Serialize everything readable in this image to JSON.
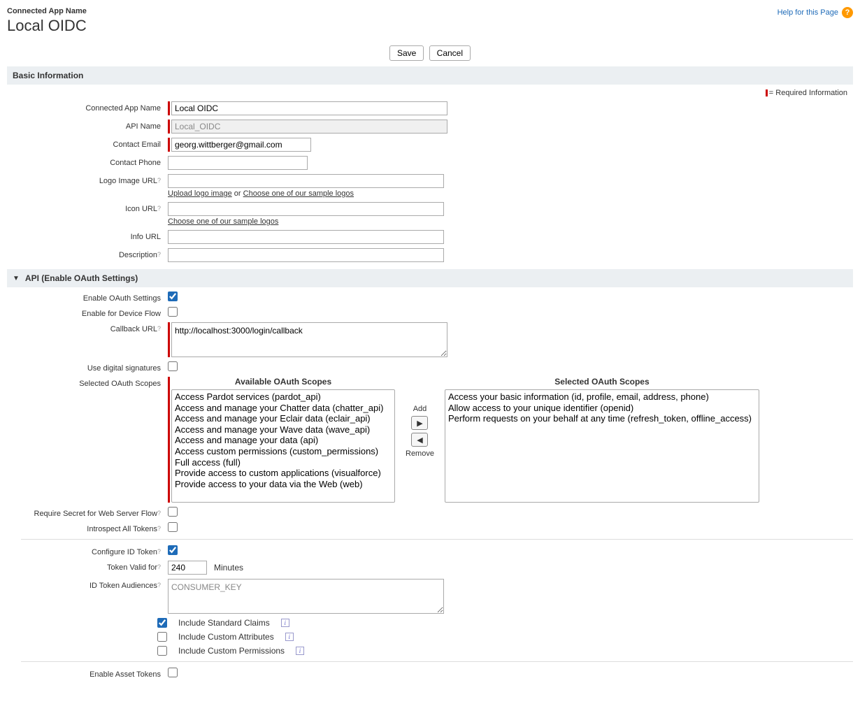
{
  "header": {
    "superlabel": "Connected App Name",
    "title": "Local OIDC",
    "help_link": "Help for this Page"
  },
  "buttons": {
    "save": "Save",
    "cancel": "Cancel"
  },
  "sections": {
    "basic_info": "Basic Information",
    "api": "API (Enable OAuth Settings)"
  },
  "required_info": "= Required Information",
  "labels": {
    "connected_app_name": "Connected App Name",
    "api_name": "API Name",
    "contact_email": "Contact Email",
    "contact_phone": "Contact Phone",
    "logo_url": "Logo Image URL",
    "icon_url": "Icon URL",
    "info_url": "Info URL",
    "description": "Description",
    "enable_oauth": "Enable OAuth Settings",
    "enable_device": "Enable for Device Flow",
    "callback_url": "Callback URL",
    "digital_sig": "Use digital signatures",
    "selected_scopes": "Selected OAuth Scopes",
    "available_scopes_title": "Available OAuth Scopes",
    "selected_scopes_title": "Selected OAuth Scopes",
    "require_secret": "Require Secret for Web Server Flow",
    "introspect": "Introspect All Tokens",
    "configure_id_token": "Configure ID Token",
    "token_valid": "Token Valid for",
    "minutes": "Minutes",
    "id_audiences": "ID Token Audiences",
    "std_claims": "Include Standard Claims",
    "custom_attrs": "Include Custom Attributes",
    "custom_perms": "Include Custom Permissions",
    "enable_asset": "Enable Asset Tokens",
    "add": "Add",
    "remove": "Remove"
  },
  "values": {
    "connected_app_name": "Local OIDC",
    "api_name": "Local_OIDC",
    "contact_email": "georg.wittberger@gmail.com",
    "contact_phone": "",
    "logo_url": "",
    "icon_url": "",
    "info_url": "",
    "description": "",
    "callback_url": "http://localhost:3000/login/callback",
    "token_valid": "240",
    "id_audiences": "CONSUMER_KEY"
  },
  "sublinks": {
    "upload_logo": "Upload logo image",
    "or": " or ",
    "sample_logos": "Choose one of our sample logos"
  },
  "scopes": {
    "available": [
      "Access Pardot services (pardot_api)",
      "Access and manage your Chatter data (chatter_api)",
      "Access and manage your Eclair data (eclair_api)",
      "Access and manage your Wave data (wave_api)",
      "Access and manage your data (api)",
      "Access custom permissions (custom_permissions)",
      "Full access (full)",
      "Provide access to custom applications (visualforce)",
      "Provide access to your data via the Web (web)"
    ],
    "selected": [
      "Access your basic information (id, profile, email, address, phone)",
      "Allow access to your unique identifier (openid)",
      "Perform requests on your behalf at any time (refresh_token, offline_access)"
    ]
  }
}
